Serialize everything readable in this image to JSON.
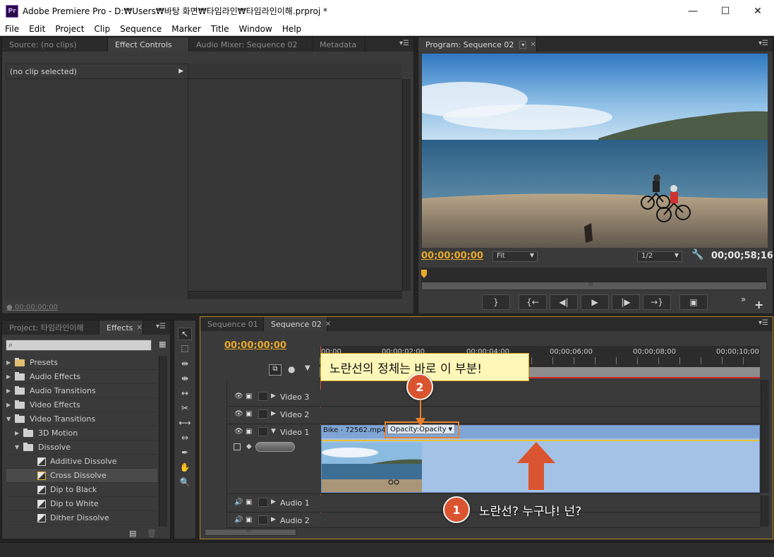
{
  "window": {
    "app_icon": "Pr",
    "title": "Adobe Premiere Pro - D:₩Users₩바탕 화면₩타임라인₩타임라인이해.prproj *",
    "minimize": "—",
    "maximize": "☐",
    "close": "✕"
  },
  "menu": [
    "File",
    "Edit",
    "Project",
    "Clip",
    "Sequence",
    "Marker",
    "Title",
    "Window",
    "Help"
  ],
  "source_panel": {
    "tabs": [
      "Source: (no clips)",
      "Effect Controls",
      "Audio Mixer: Sequence 02",
      "Metadata"
    ],
    "active_tab": "Effect Controls",
    "no_clip": "(no clip selected)",
    "timecode": "00;00;00;00"
  },
  "program_panel": {
    "tab": "Program: Sequence 02",
    "timecode_left": "00;00;00;00",
    "fit": "Fit",
    "resolution": "1/2",
    "timecode_right": "00;00;58;16",
    "ruler_marker": "III"
  },
  "project_panel": {
    "tabs": [
      "Project: 타임라인이해",
      "Effects"
    ],
    "active_tab": "Effects",
    "search_placeholder": "",
    "tree": [
      {
        "label": "Presets",
        "type": "folder",
        "level": 0,
        "expanded": false
      },
      {
        "label": "Audio Effects",
        "type": "folder",
        "level": 0,
        "expanded": false
      },
      {
        "label": "Audio Transitions",
        "type": "folder",
        "level": 0,
        "expanded": false
      },
      {
        "label": "Video Effects",
        "type": "folder",
        "level": 0,
        "expanded": false
      },
      {
        "label": "Video Transitions",
        "type": "folder",
        "level": 0,
        "expanded": true
      },
      {
        "label": "3D Motion",
        "type": "folder",
        "level": 1,
        "expanded": false
      },
      {
        "label": "Dissolve",
        "type": "folder",
        "level": 1,
        "expanded": true
      },
      {
        "label": "Additive Dissolve",
        "type": "item",
        "level": 2
      },
      {
        "label": "Cross Dissolve",
        "type": "item",
        "level": 2,
        "selected": true
      },
      {
        "label": "Dip to Black",
        "type": "item",
        "level": 2
      },
      {
        "label": "Dip to White",
        "type": "item",
        "level": 2
      },
      {
        "label": "Dither Dissolve",
        "type": "item",
        "level": 2
      }
    ]
  },
  "timeline": {
    "tabs": [
      "Sequence 01",
      "Sequence 02"
    ],
    "active_tab": "Sequence 02",
    "timecode": "00;00;00;00",
    "ruler": [
      "00;00",
      "00;00;02;00",
      "00;00;04;00",
      "00;00;06;00",
      "00;00;08;00",
      "00;00;10;00"
    ],
    "tracks": {
      "video3": "Video 3",
      "video2": "Video 2",
      "video1": "Video 1",
      "audio1": "Audio 1",
      "audio2": "Audio 2"
    },
    "clip_name": "Bike - 72562.mp4",
    "opacity_label": "Opacity:Opacity",
    "hscroll_marker": "III"
  },
  "annotations": {
    "callout_text": "노란선의 정체는 바로 이 부분!",
    "number1": "1",
    "number2": "2",
    "text1": "노란선? 누구냐! 넌?"
  },
  "colors": {
    "accent_orange": "#e8a92b",
    "annotation_red": "#d9542f",
    "clip_blue": "#a4c2e6"
  }
}
